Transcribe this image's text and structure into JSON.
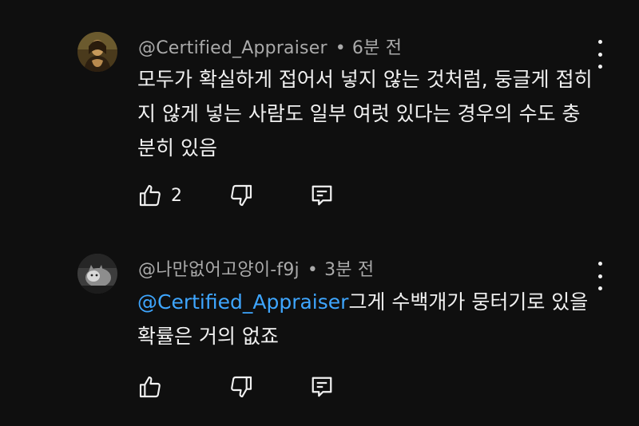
{
  "comments": [
    {
      "author": "@Certified_Appraiser",
      "separator": "•",
      "time": "6분 전",
      "mention": "",
      "text": "모두가 확실하게 접어서 넣지 않는 것처럼, 둥글게 접히지 않게 넣는 사람도 일부 여럿 있다는 경우의 수도 충분히 있음",
      "like_count": "2",
      "avatar_icon": "mona-lisa-avatar",
      "more_icon": "more-vertical-icon"
    },
    {
      "author": "@나만없어고양이-f9j",
      "separator": "•",
      "time": "3분 전",
      "mention": "@Certified_Appraiser",
      "text": "그게 수백개가 뭉터기로 있을 확률은 거의 없죠",
      "like_count": "",
      "avatar_icon": "cat-avatar",
      "more_icon": "more-vertical-icon"
    }
  ],
  "colors": {
    "background": "#0f0f0f",
    "text": "#f1f1f1",
    "meta": "#aaaaaa",
    "mention": "#3ea6ff"
  }
}
